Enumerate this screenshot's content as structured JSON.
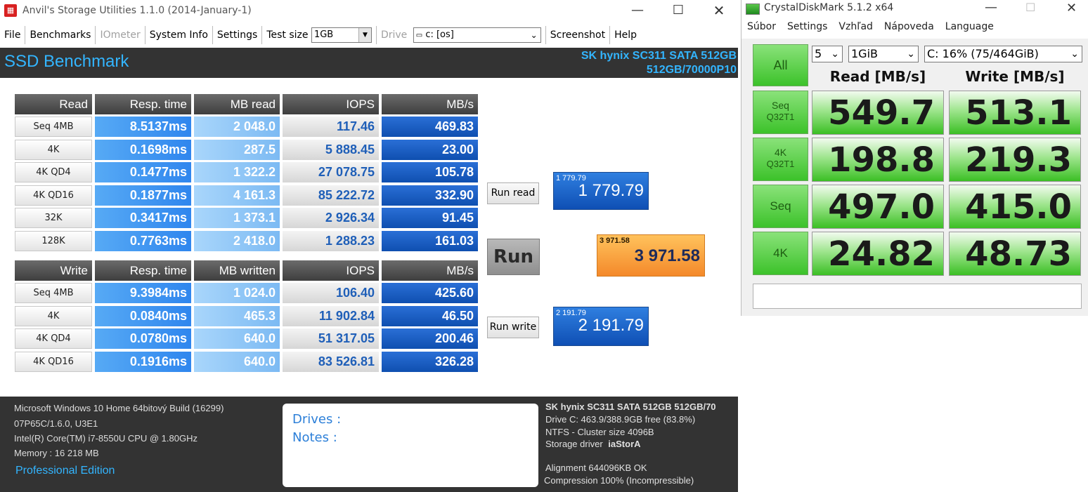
{
  "anvil": {
    "window_title": "Anvil's Storage Utilities 1.1.0 (2014-January-1)",
    "app_icon_glyph": "▦",
    "menu": {
      "file": "File",
      "benchmarks": "Benchmarks",
      "iometer": "IOmeter",
      "sysinfo": "System Info",
      "settings": "Settings",
      "testsize_label": "Test size",
      "testsize_value": "1GB",
      "drive_label": "Drive",
      "drive_value": "c: [os]",
      "screenshot": "Screenshot",
      "help": "Help"
    },
    "header": {
      "title": "SSD Benchmark",
      "device_line1": "SK hynix SC311 SATA 512GB",
      "device_line2": "512GB/70000P10"
    },
    "read_table": {
      "headers": [
        "Read",
        "Resp. time",
        "MB read",
        "IOPS",
        "MB/s"
      ],
      "rows": [
        {
          "label": "Seq 4MB",
          "resp": "8.5137ms",
          "mb": "2 048.0",
          "iops": "117.46",
          "mbs": "469.83"
        },
        {
          "label": "4K",
          "resp": "0.1698ms",
          "mb": "287.5",
          "iops": "5 888.45",
          "mbs": "23.00"
        },
        {
          "label": "4K QD4",
          "resp": "0.1477ms",
          "mb": "1 322.2",
          "iops": "27 078.75",
          "mbs": "105.78"
        },
        {
          "label": "4K QD16",
          "resp": "0.1877ms",
          "mb": "4 161.3",
          "iops": "85 222.72",
          "mbs": "332.90"
        },
        {
          "label": "32K",
          "resp": "0.3417ms",
          "mb": "1 373.1",
          "iops": "2 926.34",
          "mbs": "91.45"
        },
        {
          "label": "128K",
          "resp": "0.7763ms",
          "mb": "2 418.0",
          "iops": "1 288.23",
          "mbs": "161.03"
        }
      ]
    },
    "write_table": {
      "headers": [
        "Write",
        "Resp. time",
        "MB written",
        "IOPS",
        "MB/s"
      ],
      "rows": [
        {
          "label": "Seq 4MB",
          "resp": "9.3984ms",
          "mb": "1 024.0",
          "iops": "106.40",
          "mbs": "425.60"
        },
        {
          "label": "4K",
          "resp": "0.0840ms",
          "mb": "465.3",
          "iops": "11 902.84",
          "mbs": "46.50"
        },
        {
          "label": "4K QD4",
          "resp": "0.0780ms",
          "mb": "640.0",
          "iops": "51 317.05",
          "mbs": "200.46"
        },
        {
          "label": "4K QD16",
          "resp": "0.1916ms",
          "mb": "640.0",
          "iops": "83 526.81",
          "mbs": "326.28"
        }
      ]
    },
    "buttons": {
      "run_read": "Run read",
      "run": "Run",
      "run_write": "Run write"
    },
    "scores": {
      "read_small": "1 779.79",
      "read_big": "1 779.79",
      "total_small": "3 971.58",
      "total_big": "3 971.58",
      "write_small": "2 191.79",
      "write_big": "2 191.79"
    },
    "footer": {
      "os": "Microsoft Windows 10 Home 64bitový Build (16299)",
      "board": "07P65C/1.6.0, U3E1",
      "cpu": "Intel(R) Core(TM) i7-8550U CPU @ 1.80GHz",
      "memory": "Memory : 16 218 MB",
      "edition": "Professional Edition",
      "drives_label": "Drives :",
      "notes_label": "Notes :",
      "dev_title": "SK hynix SC311 SATA 512GB 512GB/70",
      "dev_drive": "Drive C: 463.9/388.9GB free (83.8%)",
      "dev_fs": "NTFS - Cluster size 4096B",
      "dev_driver_label": "Storage driver",
      "dev_driver_value": "iaStorA",
      "dev_align": "Alignment 644096KB OK",
      "dev_compress": "Compression 100% (Incompressible)"
    },
    "colors": {
      "accent": "#33b5ff",
      "dark": "#333333",
      "run_score": "#f7a23a"
    }
  },
  "cdm": {
    "window_title": "CrystalDiskMark 5.1.2 x64",
    "menu": [
      "Súbor",
      "Settings",
      "Vzhľad",
      "Nápoveda",
      "Language"
    ],
    "all_button": "All",
    "count": "5",
    "size": "1GiB",
    "drive": "C: 16% (75/464GiB)",
    "read_header": "Read [MB/s]",
    "write_header": "Write [MB/s]",
    "tests": [
      {
        "line1": "Seq",
        "line2": "Q32T1",
        "read": "549.7",
        "write": "513.1"
      },
      {
        "line1": "4K",
        "line2": "Q32T1",
        "read": "198.8",
        "write": "219.3"
      },
      {
        "line1": "Seq",
        "line2": "",
        "read": "497.0",
        "write": "415.0"
      },
      {
        "line1": "4K",
        "line2": "",
        "read": "24.82",
        "write": "48.73"
      }
    ],
    "comment": ""
  }
}
